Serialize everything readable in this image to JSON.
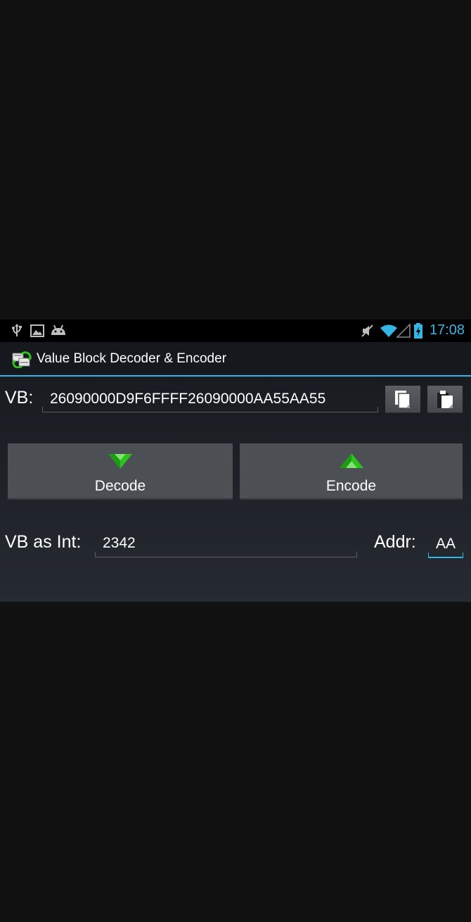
{
  "status_bar": {
    "icons_left": [
      "usb-icon",
      "image-notification-icon",
      "android-debug-icon"
    ],
    "icons_right": [
      "mute-icon",
      "wifi-icon",
      "signal-icon",
      "battery-charging-icon"
    ],
    "time": "17:08"
  },
  "title_bar": {
    "icon": "app-icon",
    "title": "Value Block Decoder & Encoder"
  },
  "vb_row": {
    "label": "VB:",
    "value": "26090000D9F6FFFF26090000AA55AA55",
    "copy_icon": "copy-icon",
    "paste_icon": "paste-icon"
  },
  "actions": {
    "decode_label": "Decode",
    "decode_icon": "arrow-down-icon",
    "encode_label": "Encode",
    "encode_icon": "arrow-up-icon"
  },
  "int_row": {
    "label": "VB as Int:",
    "value": "2342",
    "addr_label": "Addr:",
    "addr_value": "AA"
  },
  "colors": {
    "accent": "#33b5e5",
    "arrow_green": "#2ec21f",
    "button_bg": "#4c4f53"
  }
}
